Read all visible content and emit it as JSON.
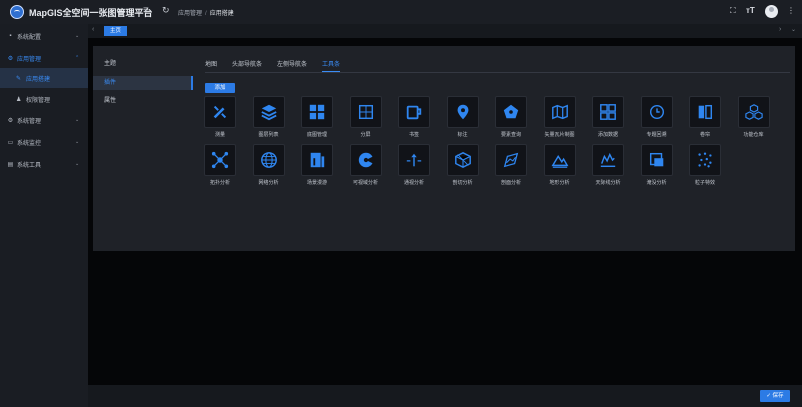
{
  "header": {
    "title": "MapGIS全空间一张图管理平台",
    "breadcrumb": [
      "应用管理",
      "应用搭建"
    ],
    "breadcrumb_sep": "/"
  },
  "sidebar": {
    "items": [
      {
        "label": "系统配置",
        "icon": "grid-icon"
      },
      {
        "label": "应用管理",
        "icon": "gear-icon",
        "open": true
      },
      {
        "label": "系统管理",
        "icon": "gear-icon"
      },
      {
        "label": "系统监控",
        "icon": "monitor-icon"
      },
      {
        "label": "系统工具",
        "icon": "toolbox-icon"
      }
    ],
    "subitems": [
      {
        "label": "应用搭建",
        "active": true
      },
      {
        "label": "权限管理"
      }
    ]
  },
  "tabstrip": {
    "home": "主页"
  },
  "left_list": [
    "主题",
    "插件",
    "属性"
  ],
  "right_tabs": [
    "地图",
    "头部导航条",
    "左侧导航条",
    "工具条"
  ],
  "active_tab": "工具条",
  "add_label": "添加",
  "save_label": "✓ 保存",
  "accent": "#2c7be5",
  "tools": [
    {
      "label": "测量",
      "icon": "measure-icon"
    },
    {
      "label": "图层列表",
      "icon": "layers-icon"
    },
    {
      "label": "底图管理",
      "icon": "basemap-icon"
    },
    {
      "label": "分屏",
      "icon": "split-screen-icon"
    },
    {
      "label": "书签",
      "icon": "bookmark-icon"
    },
    {
      "label": "标注",
      "icon": "marker-icon"
    },
    {
      "label": "要素查询",
      "icon": "pentagon-icon"
    },
    {
      "label": "矢量瓦片制图",
      "icon": "map-icon"
    },
    {
      "label": "添加数据",
      "icon": "add-data-icon"
    },
    {
      "label": "专题回溯",
      "icon": "history-icon"
    },
    {
      "label": "卷帘",
      "icon": "swipe-icon"
    },
    {
      "label": "功能仓库",
      "icon": "cubes-icon"
    },
    {
      "label": "拓扑分析",
      "icon": "topology-icon"
    },
    {
      "label": "网络分析",
      "icon": "globe-icon"
    },
    {
      "label": "场景漫游",
      "icon": "scene-icon"
    },
    {
      "label": "可视域分析",
      "icon": "viewshed-icon"
    },
    {
      "label": "通视分析",
      "icon": "line-of-sight-icon"
    },
    {
      "label": "剖切分析",
      "icon": "cut-icon"
    },
    {
      "label": "剖面分析",
      "icon": "profile-icon"
    },
    {
      "label": "地形分析",
      "icon": "terrain-icon"
    },
    {
      "label": "天际线分析",
      "icon": "skyline-icon"
    },
    {
      "label": "淹没分析",
      "icon": "flood-icon"
    },
    {
      "label": "粒子特效",
      "icon": "particles-icon"
    }
  ]
}
